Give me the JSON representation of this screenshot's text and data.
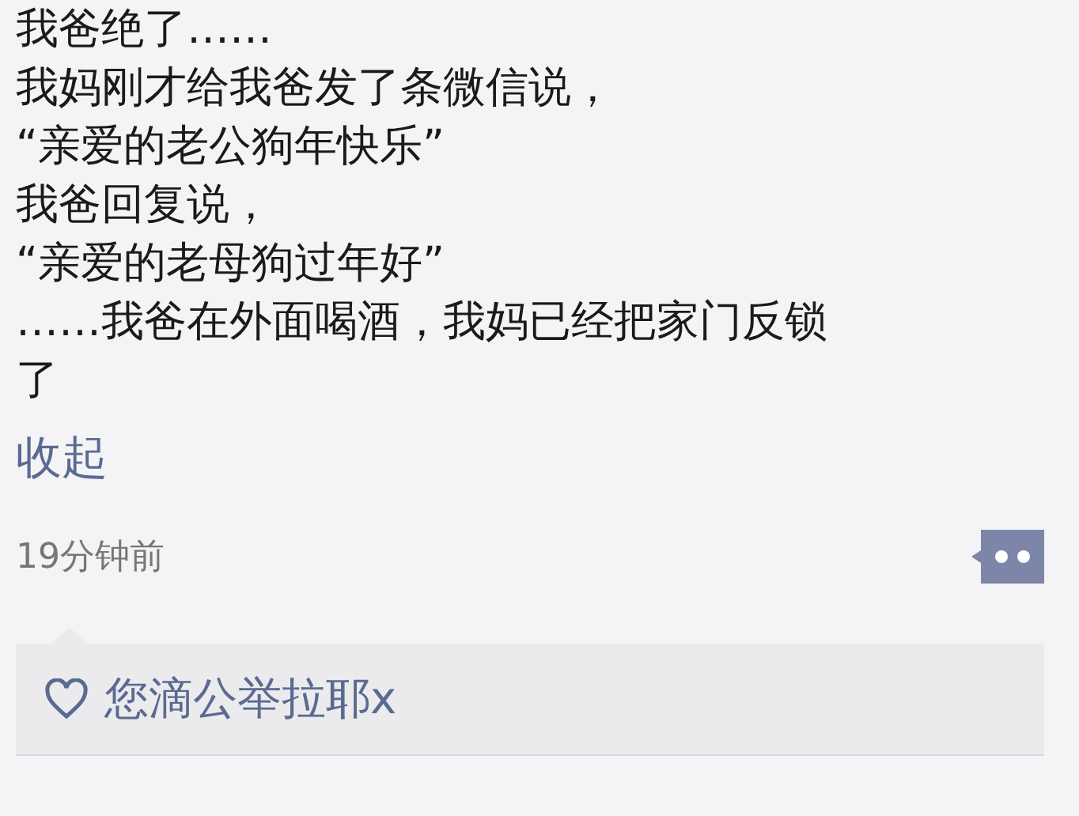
{
  "post": {
    "lines": [
      "我爸绝了……",
      "我妈刚才给我爸发了条微信说，",
      "“亲爱的老公狗年快乐”",
      "我爸回复说，",
      "“亲爱的老母狗过年好”",
      "……我爸在外面喝酒，我妈已经把家门反锁",
      "了"
    ],
    "collapse_link": "收起",
    "time": "19分钟前"
  },
  "likes": {
    "names": "您滴公举拉耶x"
  }
}
